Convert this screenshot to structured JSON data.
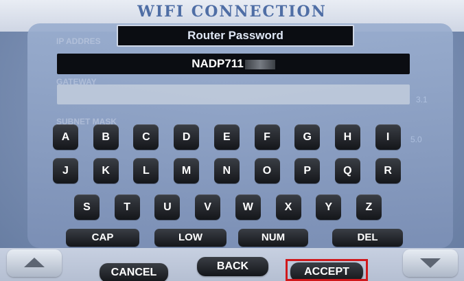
{
  "header": {
    "title": "WIFI CONNECTION"
  },
  "background_form": {
    "ip_address_label": "IP ADDRES",
    "gateway_label": "GATEWAY",
    "gateway_value_fragment": "3.1",
    "subnet_mask_label": "SUBNET MASK",
    "subnet_value_fragment": "5.0"
  },
  "dialog": {
    "title": "Router Password",
    "password_value": "NADP711"
  },
  "keyboard": {
    "row1": [
      "A",
      "B",
      "C",
      "D",
      "E",
      "F",
      "G",
      "H",
      "I"
    ],
    "row2": [
      "J",
      "K",
      "L",
      "M",
      "N",
      "O",
      "P",
      "Q",
      "R"
    ],
    "row3": [
      "S",
      "T",
      "U",
      "V",
      "W",
      "X",
      "Y",
      "Z"
    ],
    "function_keys": [
      "CAP",
      "LOW",
      "NUM",
      "DEL"
    ]
  },
  "footer": {
    "cancel_label": "CANCEL",
    "back_label": "BACK",
    "accept_label": "ACCEPT",
    "up_icon": "triangle-up-icon",
    "down_icon": "triangle-down-icon"
  },
  "colors": {
    "highlight": "#d0181b",
    "title_text": "#4f6ea5",
    "key_face": "#14161a"
  }
}
